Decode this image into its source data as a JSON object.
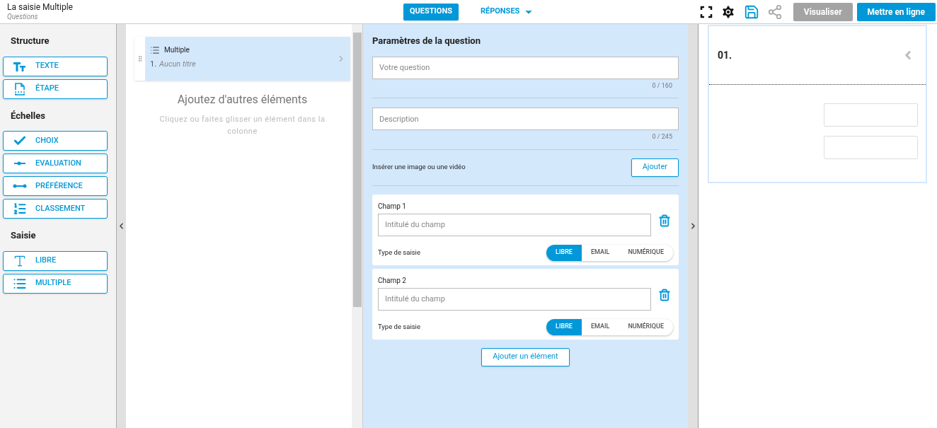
{
  "header": {
    "title": "La saisie Multiple",
    "subtitle": "Questions"
  },
  "nav_tabs": [
    {
      "label": "QUESTIONS",
      "selected": true,
      "dropdown": false
    },
    {
      "label": "RÉPONSES",
      "selected": false,
      "dropdown": true
    }
  ],
  "toolbar_buttons": [
    {
      "label": "Visualiser",
      "kind": "secondary"
    },
    {
      "label": "Mettre en ligne",
      "kind": "primary"
    }
  ],
  "sidebar": {
    "sections": [
      {
        "title": "Structure",
        "items": [
          {
            "label": "TEXTE",
            "kind": "text"
          },
          {
            "label": "ÉTAPE",
            "kind": "step"
          }
        ]
      },
      {
        "title": "Échelles",
        "items": [
          {
            "label": "CHOIX",
            "kind": "check"
          },
          {
            "label": "EVALUATION",
            "kind": "slider"
          },
          {
            "label": "PRÉFÉRENCE",
            "kind": "range"
          },
          {
            "label": "CLASSEMENT",
            "kind": "ranking"
          }
        ]
      },
      {
        "title": "Saisie",
        "items": [
          {
            "label": "LIBRE",
            "kind": "free"
          },
          {
            "label": "MULTIPLE",
            "kind": "list"
          }
        ]
      }
    ]
  },
  "question_list": {
    "items": [
      {
        "type": "Multiple",
        "number": "1.",
        "title": "Aucun titre",
        "selected": true
      }
    ],
    "empty_title": "Ajoutez d'autres éléments",
    "empty_hint": "Cliquez ou faites glisser un élément dans la colonne"
  },
  "settings": {
    "title": "Paramètres de la question",
    "question": {
      "placeholder": "Votre question",
      "counter": "0 / 160"
    },
    "description": {
      "placeholder": "Description",
      "counter": "0 / 245"
    },
    "media": {
      "label": "Insérer une image ou une vidéo",
      "button": "Ajouter"
    },
    "fields": [
      {
        "label": "Champ 1",
        "placeholder": "Intitulé du champ",
        "type_label": "Type de saisie",
        "types": [
          {
            "label": "LIBRE",
            "selected": true
          },
          {
            "label": "EMAIL",
            "selected": false
          },
          {
            "label": "NUMÉRIQUE",
            "selected": false
          }
        ]
      },
      {
        "label": "Champ 2",
        "placeholder": "Intitulé du champ",
        "type_label": "Type de saisie",
        "types": [
          {
            "label": "LIBRE",
            "selected": true
          },
          {
            "label": "EMAIL",
            "selected": false
          },
          {
            "label": "NUMÉRIQUE",
            "selected": false
          }
        ]
      }
    ],
    "add_button": "Ajouter un élément"
  },
  "preview": {
    "number": "01."
  }
}
